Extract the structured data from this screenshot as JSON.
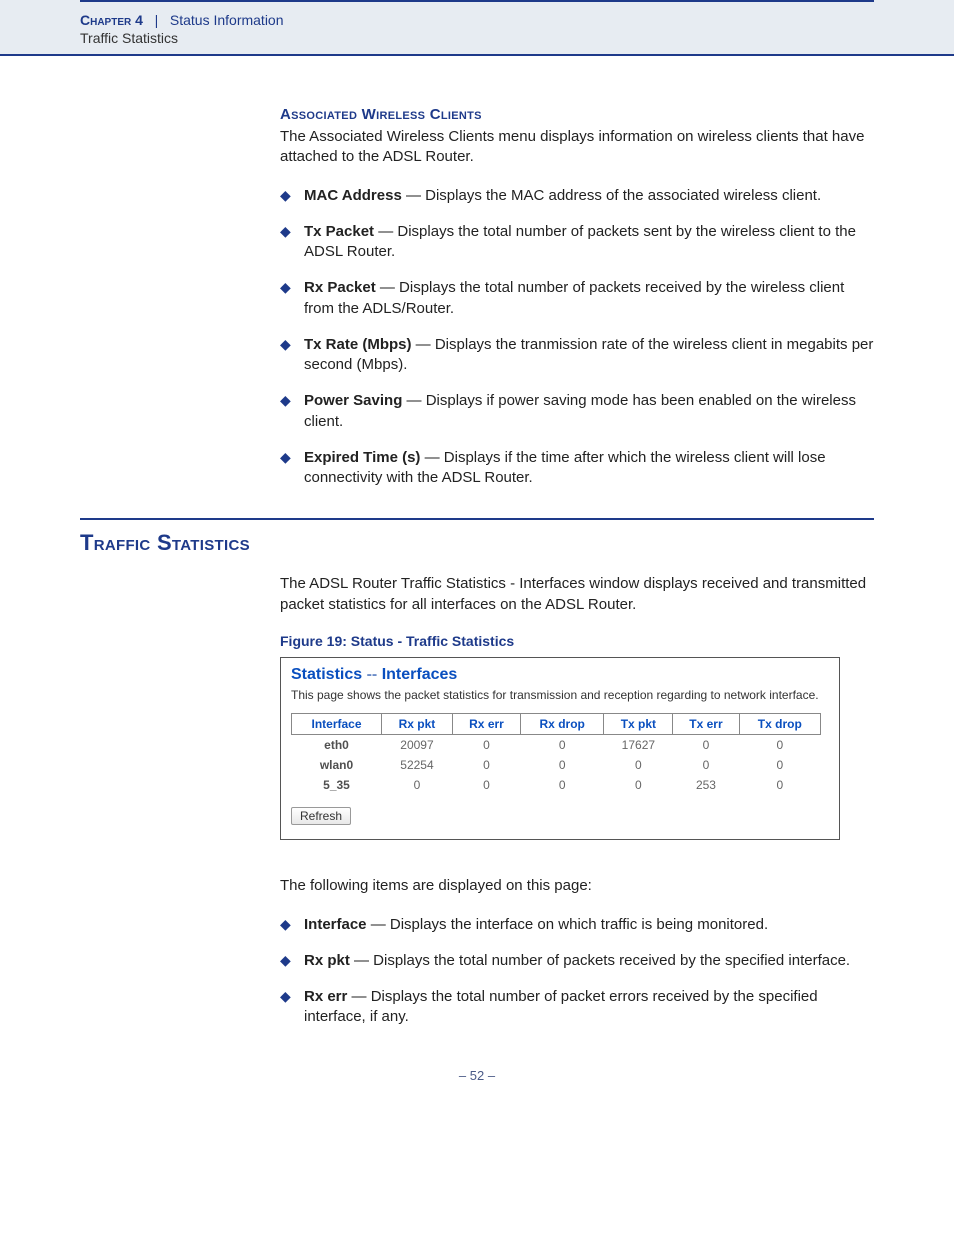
{
  "header": {
    "chapter_label": "Chapter 4",
    "separator": "|",
    "chapter_title": "Status Information",
    "subline": "Traffic Statistics"
  },
  "sec1": {
    "heading": "Associated Wireless Clients",
    "intro": "The Associated Wireless Clients menu displays information on wireless clients that have attached to the ADSL Router.",
    "items": [
      {
        "term": "MAC Address",
        "desc": " — Displays the MAC address of the associated wireless client."
      },
      {
        "term": "Tx Packet",
        "desc": " — Displays the total number of packets sent by the wireless client to the ADSL Router."
      },
      {
        "term": "Rx Packet",
        "desc": " — Displays the total number of packets received by the wireless client from the ADLS/Router."
      },
      {
        "term": "Tx Rate (Mbps)",
        "desc": " — Displays the tranmission rate of the wireless client in megabits per second (Mbps)."
      },
      {
        "term": "Power Saving",
        "desc": " — Displays if power saving mode has been enabled on the wireless client."
      },
      {
        "term": "Expired Time (s)",
        "desc": " — Displays if the time after which the wireless client will lose connectivity with the ADSL Router."
      }
    ]
  },
  "sec2": {
    "heading": "Traffic Statistics",
    "intro": "The ADSL Router Traffic Statistics - Interfaces window displays received and transmitted packet statistics for all interfaces on the ADSL Router.",
    "figure_caption": "Figure 19:  Status - Traffic Statistics",
    "post_intro": "The following items are displayed on this page:",
    "items": [
      {
        "term": "Interface",
        "desc": " — Displays the interface on which traffic is being monitored."
      },
      {
        "term": "Rx pkt",
        "desc": " — Displays the total number of packets received by the specified interface."
      },
      {
        "term": "Rx err",
        "desc": " — Displays the total number of packet errors received by the specified interface, if any."
      }
    ]
  },
  "screenshot": {
    "title_a": "Statistics",
    "title_dashes": " -- ",
    "title_b": "Interfaces",
    "desc": "This page shows the packet statistics for transmission and reception regarding to network interface.",
    "refresh": "Refresh"
  },
  "chart_data": {
    "type": "table",
    "columns": [
      "Interface",
      "Rx pkt",
      "Rx err",
      "Rx drop",
      "Tx pkt",
      "Tx err",
      "Tx drop"
    ],
    "rows": [
      {
        "Interface": "eth0",
        "Rx pkt": "20097",
        "Rx err": "0",
        "Rx drop": "0",
        "Tx pkt": "17627",
        "Tx err": "0",
        "Tx drop": "0"
      },
      {
        "Interface": "wlan0",
        "Rx pkt": "52254",
        "Rx err": "0",
        "Rx drop": "0",
        "Tx pkt": "0",
        "Tx err": "0",
        "Tx drop": "0"
      },
      {
        "Interface": "5_35",
        "Rx pkt": "0",
        "Rx err": "0",
        "Rx drop": "0",
        "Tx pkt": "0",
        "Tx err": "253",
        "Tx drop": "0"
      }
    ]
  },
  "page_number": "–  52  –"
}
